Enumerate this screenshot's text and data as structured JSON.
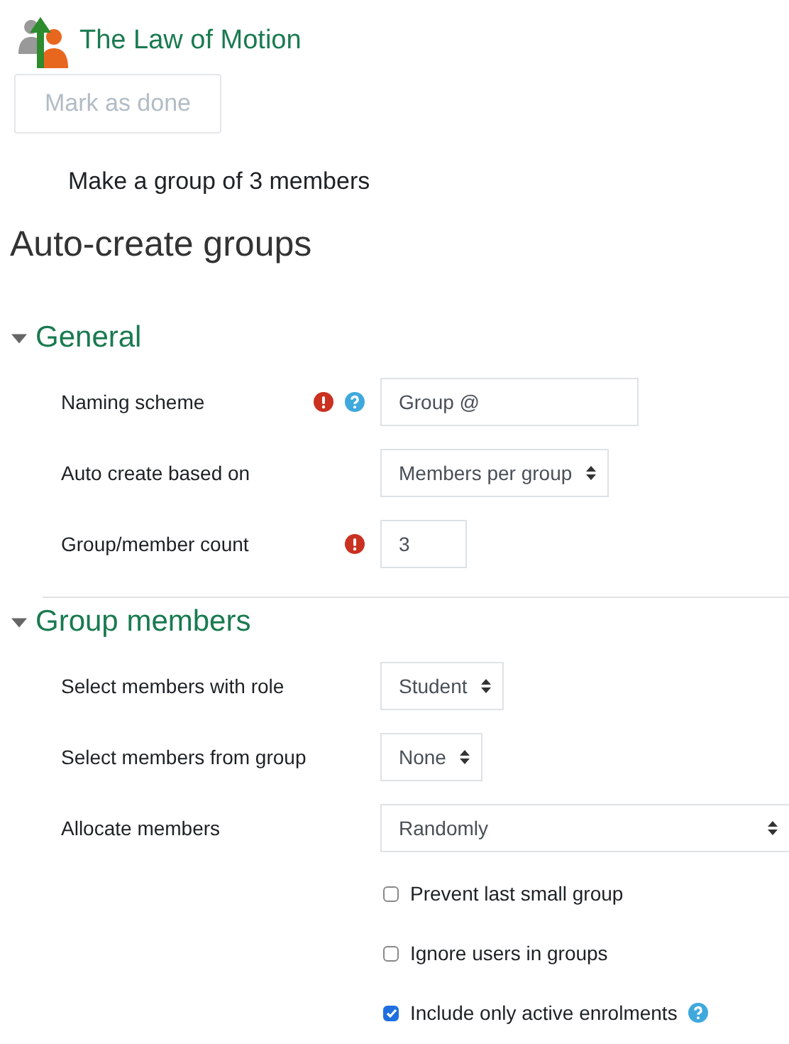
{
  "activity": {
    "title": "The Law of Motion",
    "button": {
      "label": "Mark as done",
      "disabled": true
    },
    "description": "Make a group of 3 members"
  },
  "heading": "Auto-create groups",
  "sections": [
    {
      "title": "General",
      "expanded": true,
      "rows": [
        {
          "kind": "input",
          "label": "Naming scheme",
          "required": true,
          "help": true,
          "value": "Group @"
        },
        {
          "kind": "select",
          "label": "Auto create based on",
          "required": false,
          "help": false,
          "value": "Members per group"
        },
        {
          "kind": "number",
          "label": "Group/member count",
          "required": true,
          "help": false,
          "value": "3"
        }
      ]
    },
    {
      "title": "Group members",
      "expanded": true,
      "rows": [
        {
          "kind": "select",
          "label": "Select members with role",
          "required": false,
          "help": false,
          "value": "Student"
        },
        {
          "kind": "select",
          "label": "Select members from group",
          "required": false,
          "help": false,
          "value": "None"
        },
        {
          "kind": "wideselect",
          "label": "Allocate members",
          "required": false,
          "help": false,
          "value": "Randomly"
        },
        {
          "kind": "checkbox",
          "label": "Prevent last small group",
          "checked": false,
          "help": false
        },
        {
          "kind": "checkbox",
          "label": "Ignore users in groups",
          "checked": false,
          "help": false
        },
        {
          "kind": "checkbox",
          "label": "Include only active enrolments",
          "checked": true,
          "help": true
        }
      ]
    }
  ]
}
